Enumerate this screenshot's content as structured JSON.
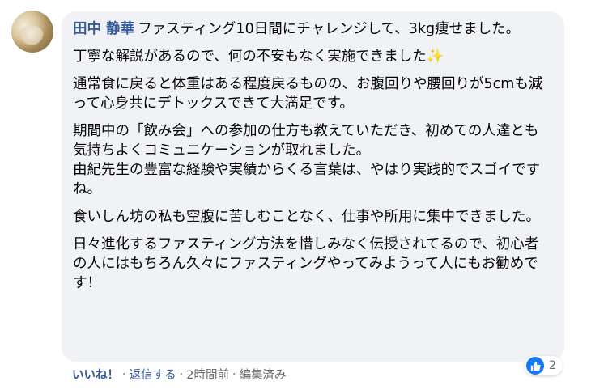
{
  "comment": {
    "author": "田中 静華",
    "paragraphs": [
      "ファスティング10日間にチャレンジして、3kg痩せました。",
      "丁寧な解説があるので、何の不安もなく実施できました",
      "通常食に戻ると体重はある程度戻るものの、お腹回りや腰回りが5cmも減って心身共にデトックスできて大満足です。",
      "期間中の「飲み会」への参加の仕方も教えていただき、初めての人達とも気持ちよくコミュニケーションが取れました。",
      "由紀先生の豊富な経験や実績からくる言葉は、やはり実践的でスゴイですね。",
      "食いしん坊の私も空腹に苦しむことなく、仕事や所用に集中できました。",
      "日々進化するファスティング方法を惜しみなく伝授されてるので、初心者の人にはもちろん久々にファスティングやってみようって人にもお勧めです！"
    ],
    "sparkle_icon": "sparkles-icon"
  },
  "reactions": {
    "icon": "like-icon",
    "count": "2"
  },
  "actions": {
    "like": "いいね！",
    "reply": "返信する",
    "time": "2時間前",
    "edited": "編集済み",
    "separator": "·"
  },
  "colors": {
    "author": "#385898",
    "bubble": "#f0f2f5",
    "like": "#1877f2",
    "meta": "#65676b"
  }
}
